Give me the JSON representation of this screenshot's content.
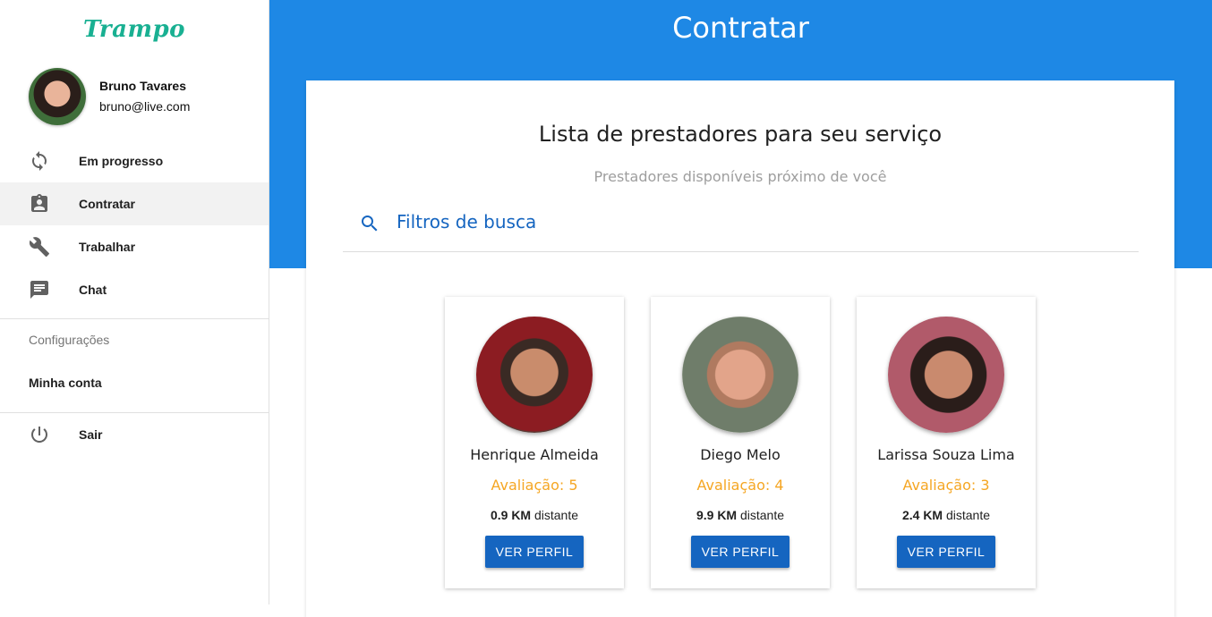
{
  "sidebar": {
    "logo": "Trampo",
    "user": {
      "name": "Bruno Tavares",
      "email": "bruno@live.com"
    },
    "nav": [
      {
        "label": "Em progresso",
        "icon": "sync-icon"
      },
      {
        "label": "Contratar",
        "icon": "assignment-ind-icon",
        "active": true
      },
      {
        "label": "Trabalhar",
        "icon": "wrench-icon"
      },
      {
        "label": "Chat",
        "icon": "chat-icon"
      }
    ],
    "settings_header": "Configurações",
    "account_label": "Minha conta",
    "logout_label": "Sair"
  },
  "header": {
    "title": "Contratar"
  },
  "main": {
    "title": "Lista de prestadores para seu serviço",
    "subtitle": "Prestadores disponíveis próximo de você",
    "search_label": "Filtros de busca",
    "providers": [
      {
        "name": "Henrique Almeida",
        "rating": "Avaliação: 5",
        "distance": "0.9 KM",
        "distance_suffix": "distante",
        "button": "VER PERFIL"
      },
      {
        "name": "Diego Melo",
        "rating": "Avaliação: 4",
        "distance": "9.9 KM",
        "distance_suffix": "distante",
        "button": "VER PERFIL"
      },
      {
        "name": "Larissa Souza Lima",
        "rating": "Avaliação: 3",
        "distance": "2.4 KM",
        "distance_suffix": "distante",
        "button": "VER PERFIL"
      }
    ]
  },
  "colors": {
    "primary": "#1e88e5",
    "button": "#1565c0",
    "rating": "#f5a623",
    "logo": "#19b092"
  }
}
